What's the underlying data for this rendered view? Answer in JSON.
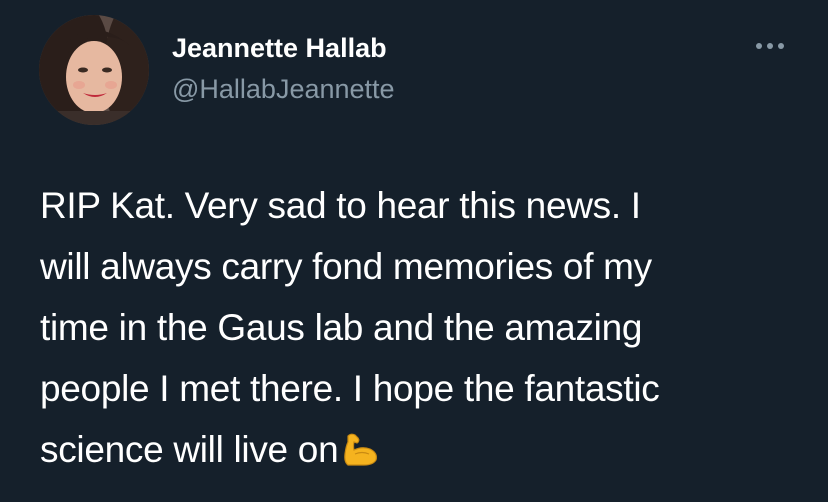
{
  "author": {
    "display_name": "Jeannette Hallab",
    "handle": "@HallabJeannette"
  },
  "tweet": {
    "lines": [
      "RIP Kat. Very sad to hear this news. I",
      "will always carry fond memories of my",
      "time in the Gaus lab and the amazing",
      "people I met there. I hope the fantastic",
      "science will live on"
    ],
    "emoji": "flexed-biceps-icon"
  },
  "menu": {
    "icon": "more-horizontal-icon"
  },
  "colors": {
    "background": "#15202b",
    "text": "#ffffff",
    "secondary_text": "#8899a6",
    "emoji": "#f5b31f"
  }
}
